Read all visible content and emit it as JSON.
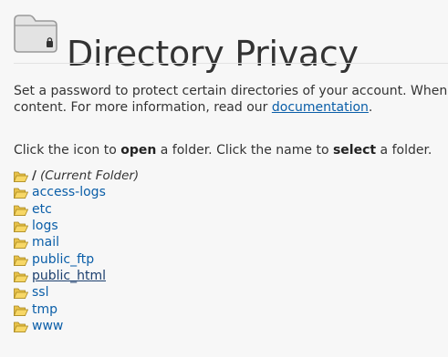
{
  "header": {
    "title": "Directory Privacy",
    "icon": "folder-lock-icon"
  },
  "intro": {
    "text_before": "Set a password to protect certain directories of your account. When you e",
    "text_line2": "content. For more information, read our ",
    "link_label": "documentation",
    "text_after": "."
  },
  "instructions": {
    "part1": "Click the icon to ",
    "bold1": "open",
    "part2": " a folder. Click the name to ",
    "bold2": "select",
    "part3": " a folder."
  },
  "tree": {
    "current": {
      "slash": "/",
      "label": "(Current Folder)"
    },
    "folders": [
      {
        "name": "access-logs",
        "selected": false
      },
      {
        "name": "etc",
        "selected": false
      },
      {
        "name": "logs",
        "selected": false
      },
      {
        "name": "mail",
        "selected": false
      },
      {
        "name": "public_ftp",
        "selected": false
      },
      {
        "name": "public_html",
        "selected": true
      },
      {
        "name": "ssl",
        "selected": false
      },
      {
        "name": "tmp",
        "selected": false
      },
      {
        "name": "www",
        "selected": false
      }
    ],
    "folder_icon": "open-folder-icon"
  },
  "colors": {
    "link": "#0a5ea8",
    "selected_link": "#1c3f6e",
    "folder_yellow": "#f7d766"
  }
}
